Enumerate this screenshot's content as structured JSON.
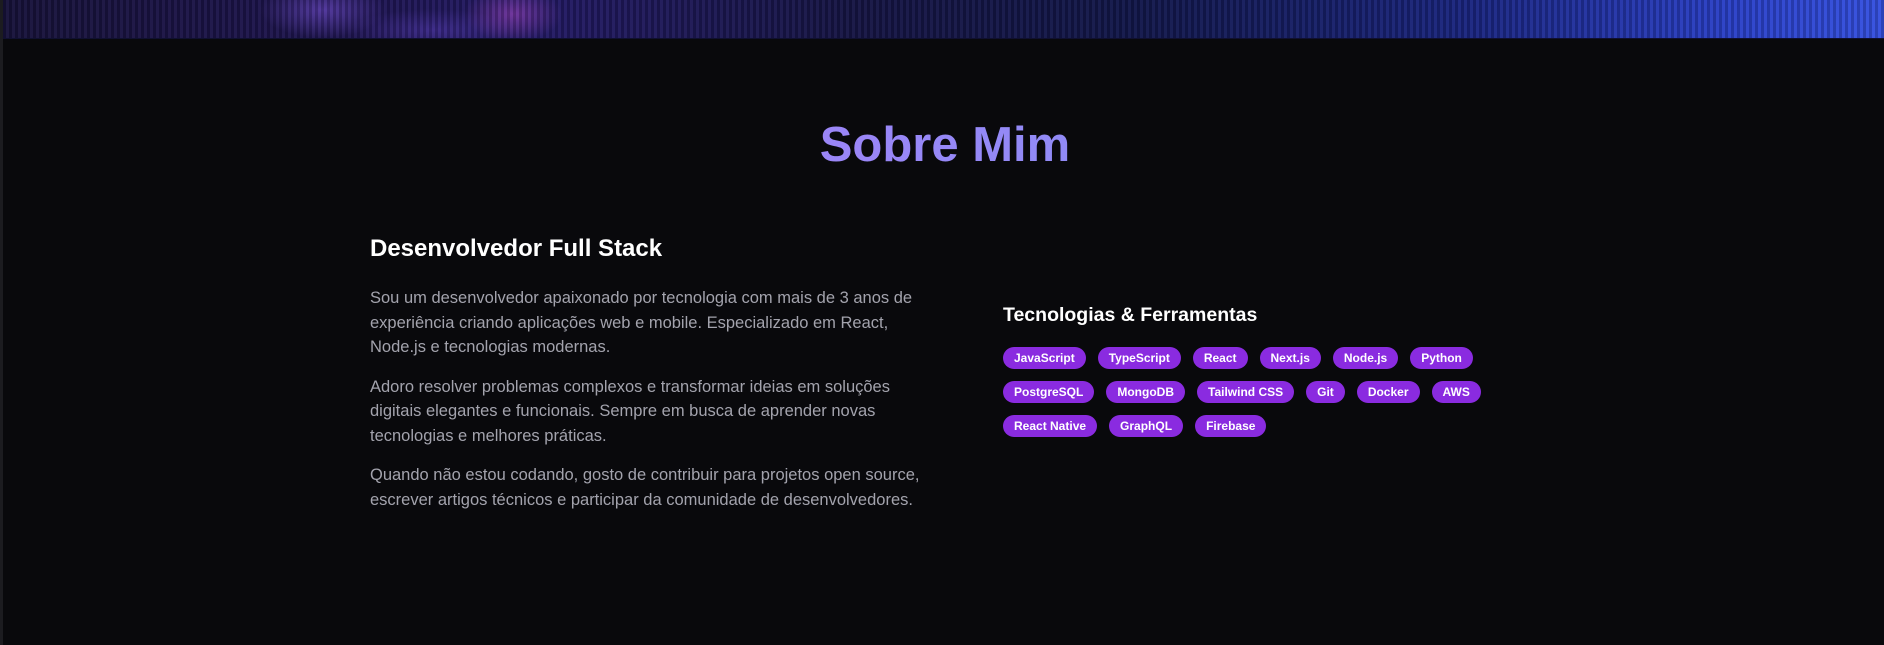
{
  "section": {
    "title": "Sobre Mim"
  },
  "about": {
    "heading": "Desenvolvedor Full Stack",
    "paragraphs": [
      "Sou um desenvolvedor apaixonado por tecnologia com mais de 3 anos de experiência criando aplicações web e mobile. Especializado em React, Node.js e tecnologias modernas.",
      "Adoro resolver problemas complexos e transformar ideias em soluções digitais elegantes e funcionais. Sempre em busca de aprender novas tecnologias e melhores práticas.",
      "Quando não estou codando, gosto de contribuir para projetos open source, escrever artigos técnicos e participar da comunidade de desenvolvedores."
    ]
  },
  "skills": {
    "heading": "Tecnologias & Ferramentas",
    "tags": [
      "JavaScript",
      "TypeScript",
      "React",
      "Next.js",
      "Node.js",
      "Python",
      "PostgreSQL",
      "MongoDB",
      "Tailwind CSS",
      "Git",
      "Docker",
      "AWS",
      "React Native",
      "GraphQL",
      "Firebase"
    ]
  },
  "colors": {
    "background": "#09090c",
    "tag_background": "#8a2be0",
    "title_gradient_start": "#b57cf3",
    "title_gradient_end": "#6f9bf4"
  }
}
